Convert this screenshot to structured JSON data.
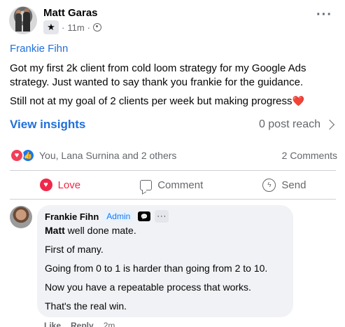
{
  "post": {
    "author": "Matt Garas",
    "time": "11m",
    "group": "Frankie Fihn",
    "paragraphs": [
      "Got my first 2k client from cold loom strategy for my Google Ads strategy. Just wanted to say thank you frankie for the guidance.",
      "Still not at my goal of 2 clients per week but making progress"
    ],
    "emoji_end": "❤️"
  },
  "insights": {
    "view_label": "View insights",
    "reach_label": "0 post reach"
  },
  "reactions": {
    "summary": "You, Lana Surnina and 2 others",
    "comments_count": "2 Comments",
    "icons": [
      "love-reaction",
      "like-reaction"
    ]
  },
  "actions": {
    "love": "Love",
    "comment": "Comment",
    "send": "Send"
  },
  "comment": {
    "author": "Frankie Fihn",
    "badge": "Admin",
    "mention": "Matt",
    "first_line_rest": " well done mate.",
    "lines": [
      "First of many.",
      "Going from 0 to 1 is harder than going from 2 to 10.",
      "Now you have a repeatable process that works.",
      "That's the real win."
    ],
    "like_label": "Like",
    "reply_label": "Reply",
    "time": "2m"
  },
  "colors": {
    "link_blue": "#216fdb",
    "love_red": "#f02849",
    "muted": "#65676b",
    "bubble_bg": "#f0f2f5"
  }
}
